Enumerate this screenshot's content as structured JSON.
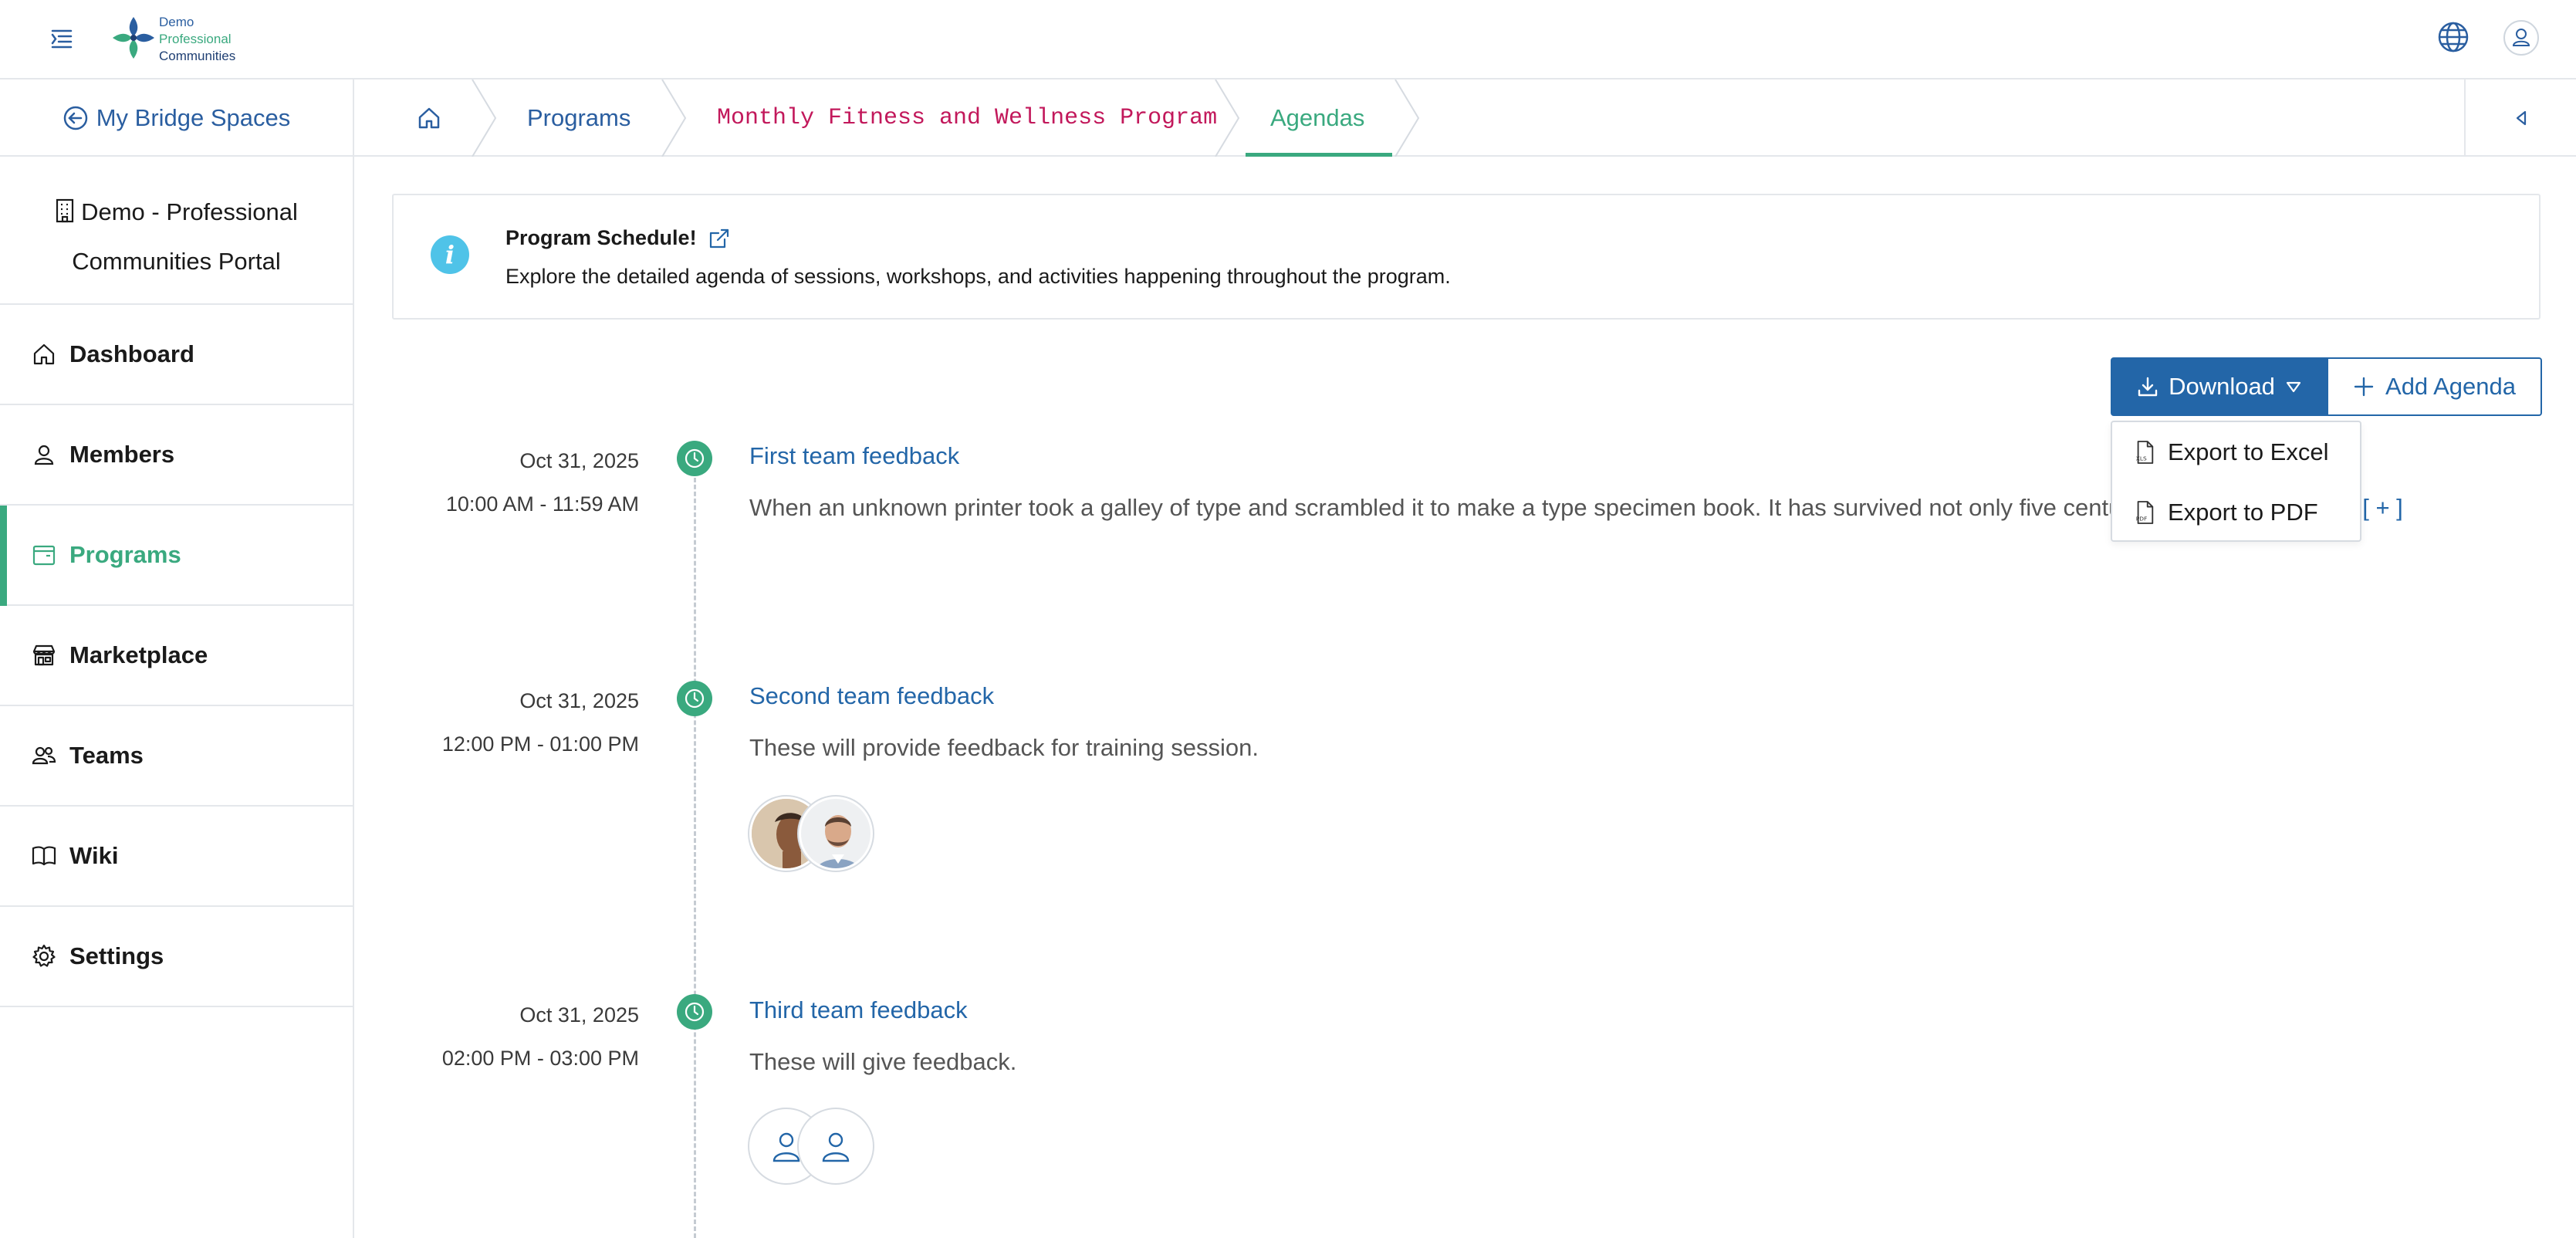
{
  "header": {
    "menu_icon": "menu-collapse-icon",
    "logo": {
      "line1": "Demo",
      "line2": "Professional",
      "line3": "Communities"
    },
    "globe_icon": "globe-icon",
    "user_icon": "user-icon"
  },
  "breadcrumbs": {
    "back_label": "My Bridge Spaces",
    "home_icon": "home-icon",
    "items": [
      "Programs",
      "Monthly Fitness and Wellness Program",
      "Agendas"
    ]
  },
  "sidebar": {
    "portal_line1": "Demo - Professional",
    "portal_line2": "Communities Portal",
    "items": [
      {
        "label": "Dashboard",
        "icon": "home-icon",
        "active": false
      },
      {
        "label": "Members",
        "icon": "user-icon",
        "active": false
      },
      {
        "label": "Programs",
        "icon": "programs-icon",
        "active": true
      },
      {
        "label": "Marketplace",
        "icon": "store-icon",
        "active": false
      },
      {
        "label": "Teams",
        "icon": "team-icon",
        "active": false
      },
      {
        "label": "Wiki",
        "icon": "book-icon",
        "active": false
      },
      {
        "label": "Settings",
        "icon": "gear-icon",
        "active": false
      }
    ]
  },
  "info": {
    "title": "Program Schedule!",
    "description": "Explore the detailed agenda of sessions, workshops, and activities happening throughout the program."
  },
  "actions": {
    "download_label": "Download",
    "add_label": "Add Agenda",
    "dropdown": [
      "Export to Excel",
      "Export to PDF"
    ]
  },
  "agendas": [
    {
      "date": "Oct 31, 2025",
      "time": "10:00 AM - 11:59 AM",
      "title": "First team feedback",
      "description": "When an unknown printer took a galley of type and scrambled it to make a type specimen book. It has survived not only five centuries, but also the lea...",
      "more": "[ + ]"
    },
    {
      "date": "Oct 31, 2025",
      "time": "12:00 PM - 01:00 PM",
      "title": "Second team feedback",
      "description": "These will provide feedback for training session."
    },
    {
      "date": "Oct 31, 2025",
      "time": "02:00 PM - 03:00 PM",
      "title": "Third team feedback",
      "description": "These will give feedback."
    }
  ],
  "colors": {
    "primary": "#2366a8",
    "accent": "#3aa97f",
    "program_link": "#c2185b",
    "info": "#4fc3e8"
  }
}
